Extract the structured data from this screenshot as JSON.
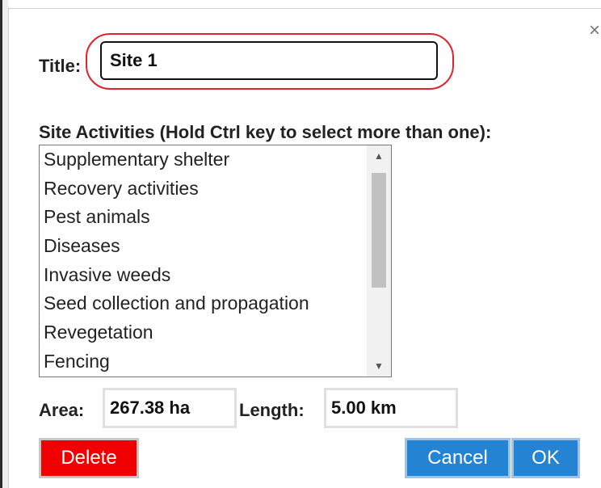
{
  "dialog": {
    "close_glyph": "×",
    "title_label": "Title:",
    "title_value": "Site 1",
    "activities_label": "Site Activities (Hold Ctrl key to select more than one):",
    "activities": [
      "Supplementary shelter",
      "Recovery activities",
      "Pest animals",
      "Diseases",
      "Invasive weeds",
      "Seed collection and propagation",
      "Revegetation",
      "Fencing"
    ],
    "area_label": "Area:",
    "area_value": "267.38 ha",
    "length_label": "Length:",
    "length_value": "5.00 km",
    "delete_label": "Delete",
    "cancel_label": "Cancel",
    "ok_label": "OK",
    "colors": {
      "delete": "#f00000",
      "primary": "#2583d4",
      "highlight_ring": "#e0222e"
    }
  }
}
